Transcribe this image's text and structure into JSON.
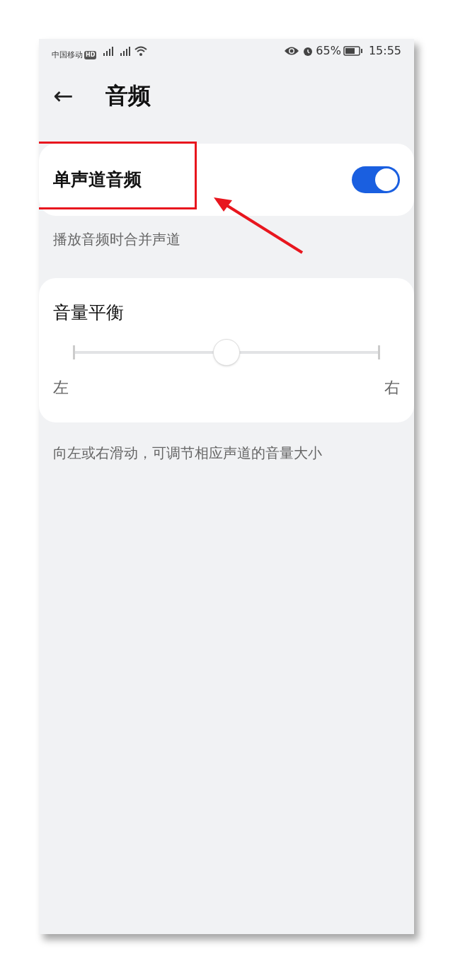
{
  "status_bar": {
    "carrier": "中国移动",
    "carrier_badge": "HD",
    "battery": "65%",
    "time": "15:55"
  },
  "header": {
    "back": "←",
    "title": "音频"
  },
  "mono_audio": {
    "label": "单声道音频",
    "on": true,
    "highlighted": true,
    "description": "播放音频时合并声道"
  },
  "balance": {
    "label": "音量平衡",
    "level": 0.5,
    "left": "左",
    "right": "右",
    "description": "向左或右滑动，可调节相应声道的音量大小"
  }
}
